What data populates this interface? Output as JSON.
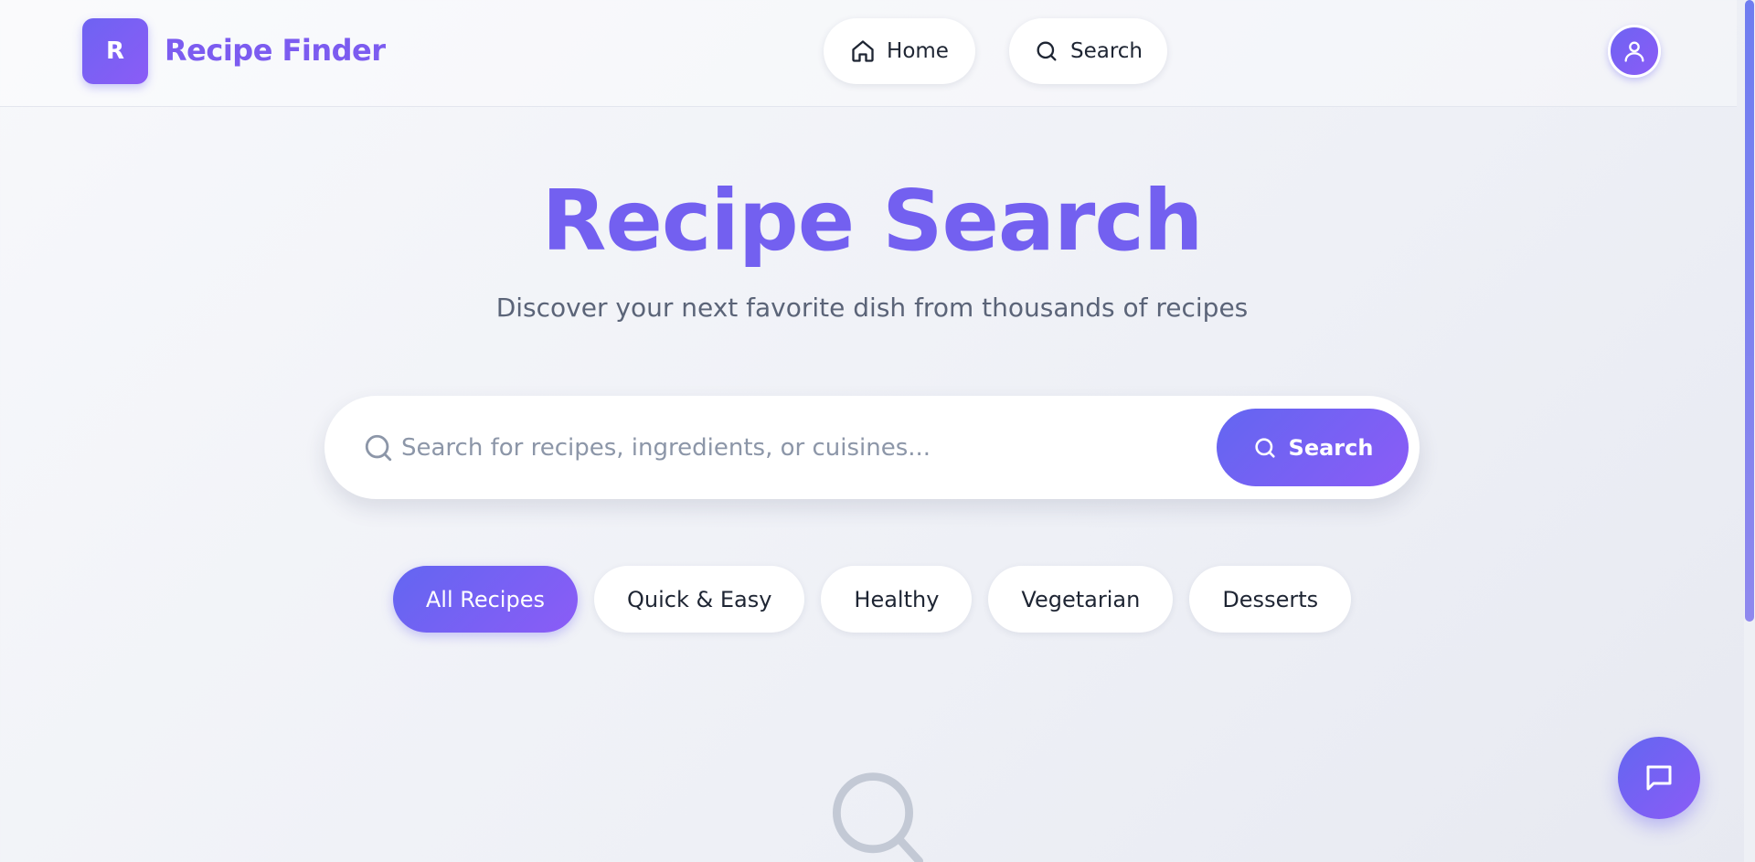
{
  "header": {
    "logo_letter": "R",
    "app_name": "Recipe Finder",
    "nav": [
      {
        "label": "Home",
        "icon": "home-icon"
      },
      {
        "label": "Search",
        "icon": "search-icon"
      }
    ],
    "profile_icon": "user-icon"
  },
  "hero": {
    "title": "Recipe Search",
    "subtitle": "Discover your next favorite dish from thousands of recipes"
  },
  "search": {
    "placeholder": "Search for recipes, ingredients, or cuisines...",
    "value": "",
    "button_label": "Search"
  },
  "filters": [
    {
      "label": "All Recipes",
      "active": true
    },
    {
      "label": "Quick & Easy",
      "active": false
    },
    {
      "label": "Healthy",
      "active": false
    },
    {
      "label": "Vegetarian",
      "active": false
    },
    {
      "label": "Desserts",
      "active": false
    }
  ],
  "empty_state": {
    "icon": "search-icon"
  },
  "chat": {
    "icon": "chat-icon"
  },
  "colors": {
    "accent": "#7360f0",
    "accent_gradient_start": "#6366f1",
    "accent_gradient_end": "#8b5cf6",
    "text": "#1e2533",
    "muted": "#5b6478"
  }
}
